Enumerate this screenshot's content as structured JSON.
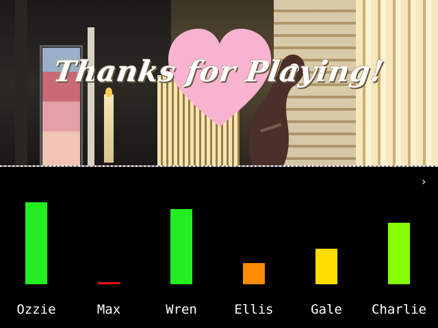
{
  "scene": {
    "title": "Thanks for Playing!"
  },
  "stats_panel": {
    "next_icon": "chevron-right-icon",
    "max_value": 100,
    "characters": [
      {
        "name": "Ozzie",
        "value": 100,
        "color": "#22ee22"
      },
      {
        "name": "Max",
        "value": 2,
        "color": "#ee1111"
      },
      {
        "name": "Wren",
        "value": 92,
        "color": "#22ee22"
      },
      {
        "name": "Ellis",
        "value": 26,
        "color": "#ff8c00"
      },
      {
        "name": "Gale",
        "value": 43,
        "color": "#ffdd00"
      },
      {
        "name": "Charlie",
        "value": 75,
        "color": "#88ff00"
      }
    ]
  }
}
